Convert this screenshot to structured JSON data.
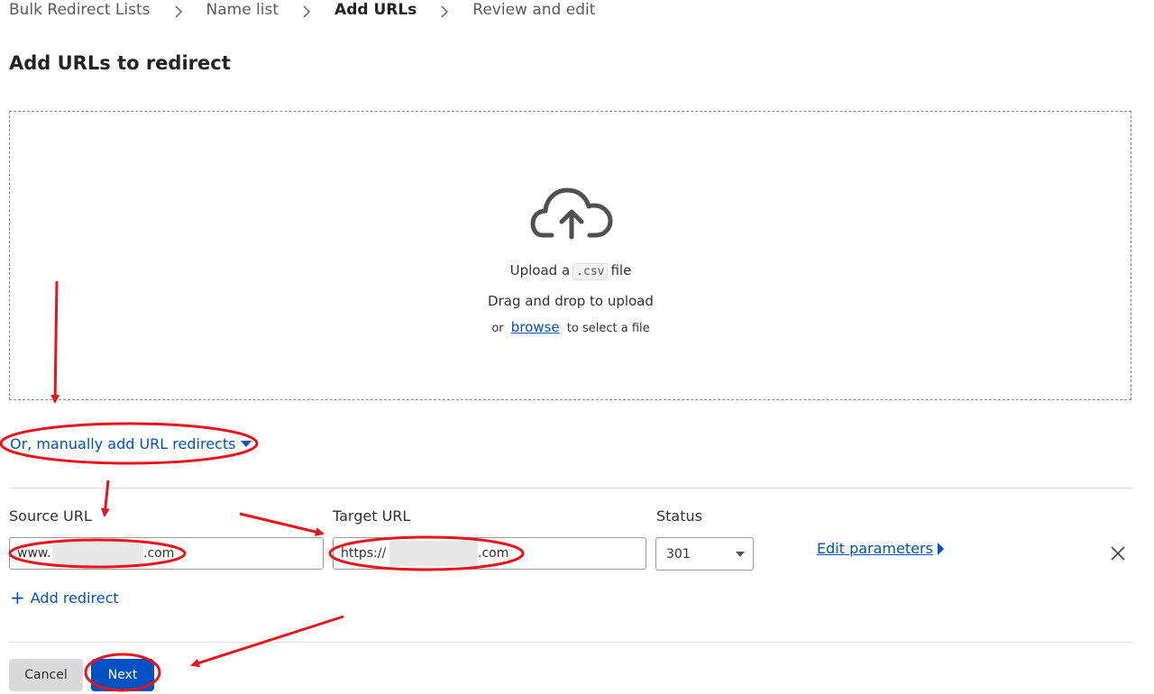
{
  "breadcrumb": {
    "items": [
      {
        "label": "Bulk Redirect Lists"
      },
      {
        "label": "Name list"
      },
      {
        "label": "Add URLs"
      },
      {
        "label": "Review and edit"
      }
    ]
  },
  "page": {
    "title": "Add URLs to redirect"
  },
  "upload": {
    "icon": "cloud-upload-icon",
    "prefix": "Upload a",
    "file_type": ".csv",
    "suffix": "file",
    "drag_text": "Drag and drop to upload",
    "or_text": "or",
    "browse_label": "browse",
    "select_text": "to select a file"
  },
  "manual": {
    "toggle_label": "Or, manually add URL redirects"
  },
  "redirect_row": {
    "source_label": "Source URL",
    "source_prefix": "www.",
    "source_suffix": ".com",
    "target_label": "Target URL",
    "target_prefix": "https://",
    "target_suffix": ".com",
    "status_label": "Status",
    "status_value": "301",
    "edit_params_label": "Edit parameters"
  },
  "add_redirect_label": "Add redirect",
  "footer": {
    "cancel_label": "Cancel",
    "next_label": "Next"
  },
  "colors": {
    "link": "#0051c3",
    "annotation": "#e8141b",
    "primary_button": "#0051c3"
  }
}
